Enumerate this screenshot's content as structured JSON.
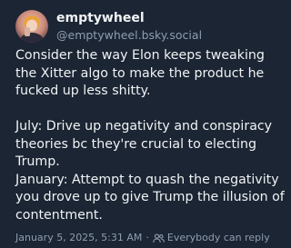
{
  "author": {
    "display_name": "emptywheel",
    "handle": "@emptywheel.bsky.social"
  },
  "post": {
    "paragraph1": "Consider the way Elon keeps tweaking the Xitter algo to make the product he fucked up less shitty.",
    "paragraph2": "July: Drive up negativity and conspiracy theories bc they're crucial to electing Trump.",
    "paragraph3": "January: Attempt to quash the negativity you drove up to give Trump the illusion of contentment."
  },
  "meta": {
    "timestamp": "January 5, 2025, 5:31 AM",
    "separator": "·",
    "reply_setting": "Everybody can reply",
    "reply_icon": "people-icon"
  },
  "colors": {
    "background": "#1b2533",
    "text_primary": "#f1f3f5",
    "text_secondary": "#8f9db0"
  }
}
